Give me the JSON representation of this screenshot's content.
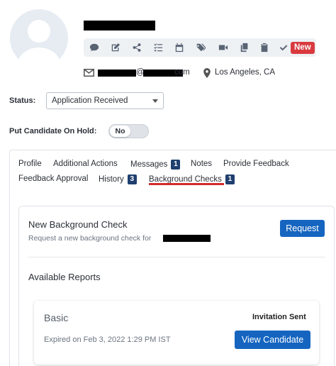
{
  "candidate": {
    "email_suffix": "com",
    "email_at": "@",
    "location": "Los Angeles, CA"
  },
  "actions": [
    {
      "icon": "comment-icon"
    },
    {
      "icon": "edit-icon"
    },
    {
      "icon": "share-icon"
    },
    {
      "icon": "checklist-icon"
    },
    {
      "icon": "calendar-icon"
    },
    {
      "icon": "tags-icon"
    },
    {
      "icon": "video-icon"
    },
    {
      "icon": "copy-icon"
    },
    {
      "icon": "clipboard-icon"
    },
    {
      "icon": "check-icon"
    }
  ],
  "new_badge": "New",
  "status": {
    "label": "Status:",
    "value": "Application Received"
  },
  "hold": {
    "label": "Put Candidate On Hold:",
    "value": "No"
  },
  "tabs": [
    {
      "label": "Profile"
    },
    {
      "label": "Additional Actions"
    },
    {
      "label": "Messages",
      "count": "1"
    },
    {
      "label": "Notes"
    },
    {
      "label": "Provide Feedback"
    },
    {
      "label": "Feedback Approval"
    },
    {
      "label": "History",
      "count": "3"
    },
    {
      "label": "Background Checks",
      "count": "1",
      "active": true
    }
  ],
  "new_check": {
    "title": "New Background Check",
    "subtitle": "Request a new background check for",
    "button": "Request"
  },
  "reports": {
    "title": "Available Reports",
    "items": [
      {
        "name": "Basic",
        "status": "Invitation Sent",
        "expired": "Expired on Feb 3, 2022 1:29 PM IST",
        "button": "View Candidate"
      }
    ]
  },
  "colors": {
    "primary": "#1565c0",
    "badge_new": "#d93a3f",
    "tab_active": "#d42a2a",
    "count_badge": "#1f3f6e"
  }
}
